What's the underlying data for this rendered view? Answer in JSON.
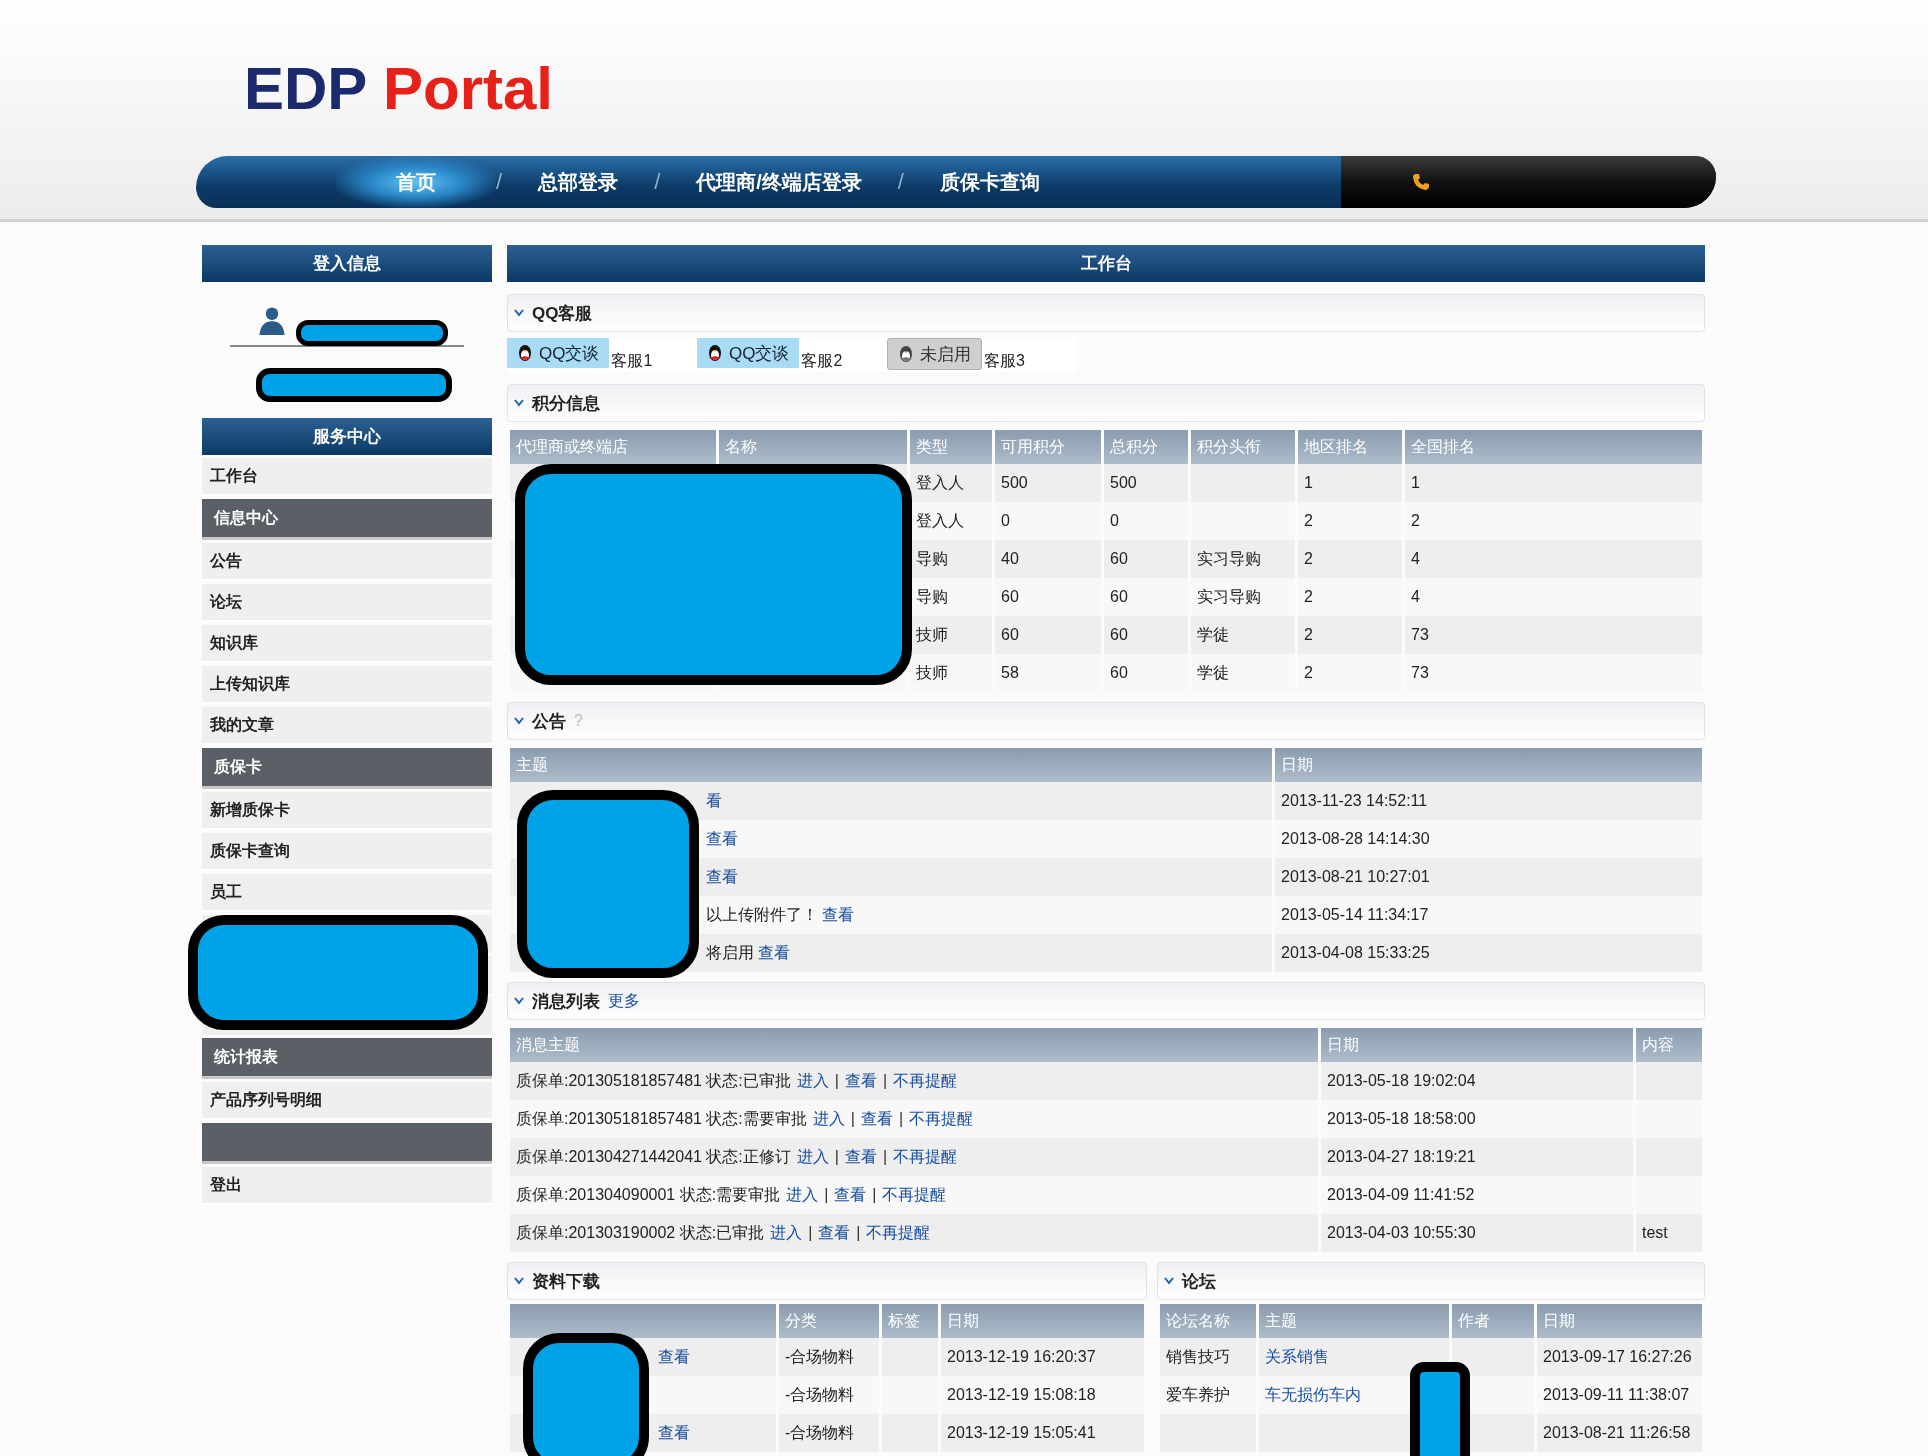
{
  "logo": {
    "first": "EDP",
    "second": "Portal"
  },
  "nav": {
    "items": [
      {
        "label": "首页",
        "selected": true
      },
      {
        "label": "总部登录",
        "selected": false
      },
      {
        "label": "代理商/终端店登录",
        "selected": false
      },
      {
        "label": "质保卡查询",
        "selected": false
      }
    ],
    "separator": "/"
  },
  "sidebar": {
    "login_title": "登入信息",
    "service_title": "服务中心",
    "items": [
      {
        "kind": "item",
        "label": "工作台"
      },
      {
        "kind": "group",
        "label": "信息中心"
      },
      {
        "kind": "item",
        "label": "公告"
      },
      {
        "kind": "item",
        "label": "论坛"
      },
      {
        "kind": "item",
        "label": "知识库"
      },
      {
        "kind": "item",
        "label": "上传知识库"
      },
      {
        "kind": "item",
        "label": "我的文章"
      },
      {
        "kind": "group",
        "label": "质保卡"
      },
      {
        "kind": "item",
        "label": "新增质保卡"
      },
      {
        "kind": "item",
        "label": "质保卡查询"
      },
      {
        "kind": "item",
        "label": "员工"
      },
      {
        "kind": "blank"
      },
      {
        "kind": "blank"
      },
      {
        "kind": "blank"
      },
      {
        "kind": "group",
        "label": "统计报表"
      },
      {
        "kind": "item",
        "label": "产品序列号明细"
      },
      {
        "kind": "group"
      },
      {
        "kind": "item",
        "label": "登出"
      }
    ]
  },
  "main": {
    "title": "工作台",
    "qq": {
      "title": "QQ客服",
      "agents": [
        {
          "button": "QQ交谈",
          "name": "客服1",
          "enabled": true
        },
        {
          "button": "QQ交谈",
          "name": "客服2",
          "enabled": true
        },
        {
          "button": "未启用",
          "name": "客服3",
          "enabled": false
        }
      ]
    },
    "points": {
      "title": "积分信息",
      "columns": [
        "代理商或终端店",
        "名称",
        "类型",
        "可用积分",
        "总积分",
        "积分头衔",
        "地区排名",
        "全国排名"
      ],
      "rows": [
        {
          "type": "登入人",
          "available": "500",
          "total": "500",
          "region_rank": "1",
          "national_rank": "1"
        },
        {
          "type": "登入人",
          "available": "0",
          "total": "0",
          "region_rank": "2",
          "national_rank": "2"
        },
        {
          "type": "导购",
          "available": "40",
          "total": "60",
          "rank_title": "实习导购",
          "region_rank": "2",
          "national_rank": "4"
        },
        {
          "type": "导购",
          "available": "60",
          "total": "60",
          "rank_title": "实习导购",
          "region_rank": "2",
          "national_rank": "4"
        },
        {
          "type": "技师",
          "available": "60",
          "total": "60",
          "rank_title": "学徒",
          "region_rank": "2",
          "national_rank": "73"
        },
        {
          "type": "技师",
          "available": "58",
          "total": "60",
          "rank_title": "学徒",
          "region_rank": "2",
          "national_rank": "73"
        }
      ]
    },
    "notices": {
      "title": "公告",
      "help": "?",
      "columns": [
        "主题",
        "日期"
      ],
      "rows": [
        {
          "link": "看",
          "date": "2013-11-23 14:52:11"
        },
        {
          "link": "查看",
          "date": "2013-08-28 14:14:30"
        },
        {
          "link": "查看",
          "date": "2013-08-21 10:27:01"
        },
        {
          "text": "以上传附件了！",
          "link": "查看",
          "date": "2013-05-14 11:34:17"
        },
        {
          "text": "将启用",
          "link": "查看",
          "date": "2013-04-08 15:33:25"
        }
      ]
    },
    "messages": {
      "title": "消息列表",
      "more": "更多",
      "columns": [
        "消息主题",
        "日期",
        "内容"
      ],
      "separator": "|",
      "rows": [
        {
          "subject": "质保单:201305181857481 状态:已审批",
          "links": [
            "进入",
            "查看",
            "不再提醒"
          ],
          "date": "2013-05-18 19:02:04"
        },
        {
          "subject": "质保单:201305181857481 状态:需要审批",
          "links": [
            "进入",
            "查看",
            "不再提醒"
          ],
          "date": "2013-05-18 18:58:00"
        },
        {
          "subject": "质保单:201304271442041 状态:正修订",
          "links": [
            "进入",
            "查看",
            "不再提醒"
          ],
          "date": "2013-04-27 18:19:21"
        },
        {
          "subject": "质保单:201304090001 状态:需要审批",
          "links": [
            "进入",
            "查看",
            "不再提醒"
          ],
          "date": "2013-04-09 11:41:52"
        },
        {
          "subject": "质保单:201303190002 状态:已审批",
          "links": [
            "进入",
            "查看",
            "不再提醒"
          ],
          "date": "2013-04-03 10:55:30",
          "content": "test"
        }
      ]
    },
    "downloads": {
      "title": "资料下载",
      "columns": [
        "分类",
        "标签",
        "日期"
      ],
      "rows": [
        {
          "link": "查看",
          "category": "-合场物料",
          "date": "2013-12-19 16:20:37"
        },
        {
          "category": "-合场物料",
          "date": "2013-12-19 15:08:18"
        },
        {
          "link": "查看",
          "category": "-合场物料",
          "date": "2013-12-19 15:05:41"
        }
      ]
    },
    "forum": {
      "title": "论坛",
      "columns": [
        "论坛名称",
        "主题",
        "作者",
        "日期"
      ],
      "rows": [
        {
          "board": "销售技巧",
          "topic": "关系销售",
          "date": "2013-09-17 16:27:26"
        },
        {
          "board": "爱车养护",
          "topic": "车无损伤车内",
          "date": "2013-09-11 11:38:07"
        },
        {
          "date": "2013-08-21 11:26:58"
        }
      ]
    }
  }
}
